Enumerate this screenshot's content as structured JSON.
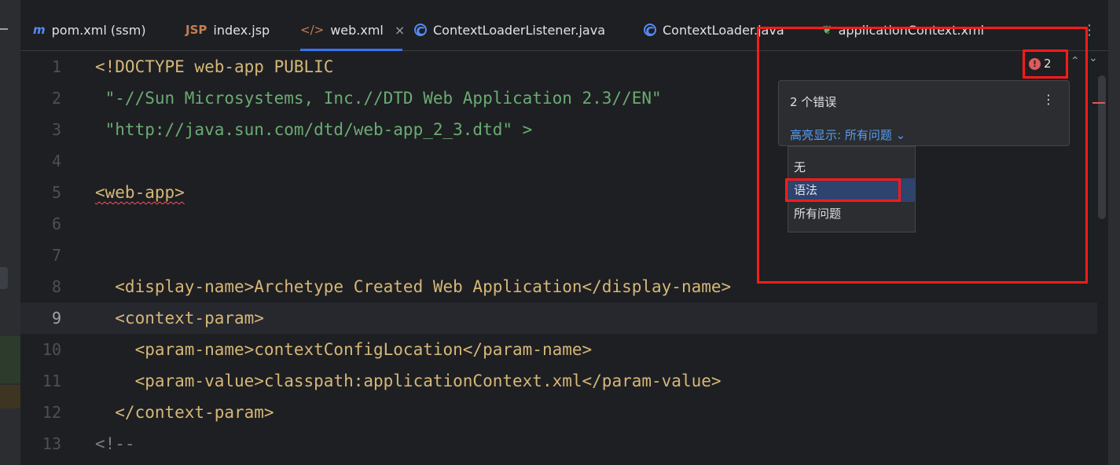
{
  "tabs": [
    {
      "label": "pom.xml (ssm)",
      "icon": "maven-icon",
      "glyph": "m",
      "active": false
    },
    {
      "label": "index.jsp",
      "icon": "jsp-file-icon",
      "glyph": "JSP",
      "active": false
    },
    {
      "label": "web.xml",
      "icon": "xml-file-icon",
      "glyph": "</>",
      "active": true
    },
    {
      "label": "ContextLoaderListener.java",
      "icon": "class-icon",
      "glyph": "C",
      "active": false
    },
    {
      "label": "ContextLoader.java",
      "icon": "class-icon",
      "glyph": "C",
      "active": false
    },
    {
      "label": "applicationContext.xml",
      "icon": "spring-xml-icon",
      "glyph": "",
      "active": false
    }
  ],
  "tab_close_glyph": "×",
  "tab_menu_glyph": "⋮",
  "editor": {
    "current_line": 9,
    "lines": [
      {
        "n": "1",
        "t": "<!DOCTYPE web-app PUBLIC"
      },
      {
        "n": "2",
        "t": " \"-//Sun Microsystems, Inc.//DTD Web Application 2.3//EN\""
      },
      {
        "n": "3",
        "t": " \"http://java.sun.com/dtd/web-app_2_3.dtd\" >"
      },
      {
        "n": "4",
        "t": ""
      },
      {
        "n": "5",
        "t": "<web-app>"
      },
      {
        "n": "6",
        "t": ""
      },
      {
        "n": "7",
        "t": ""
      },
      {
        "n": "8",
        "t": "  <display-name>Archetype Created Web Application</display-name>"
      },
      {
        "n": "9",
        "t": "  <context-param>"
      },
      {
        "n": "10",
        "t": "    <param-name>contextConfigLocation</param-name>"
      },
      {
        "n": "11",
        "t": "    <param-value>classpath:applicationContext.xml</param-value>"
      },
      {
        "n": "12",
        "t": "  </context-param>"
      },
      {
        "n": "13",
        "t": "<!--"
      }
    ]
  },
  "inspection": {
    "error_count": "2",
    "error_icon_glyph": "!",
    "prev_glyph": "⌃",
    "next_glyph": "⌄"
  },
  "popup": {
    "title": "2 个错误",
    "more_glyph": "⋮",
    "highlight_label": "高亮显示: 所有问题",
    "dropdown_arrow": "⌄"
  },
  "dropdown": {
    "selected_index": 1,
    "options": [
      "无",
      "语法",
      "所有问题"
    ]
  },
  "colors": {
    "accent": "#3574f0",
    "tag": "#d5b778",
    "string": "#6aab73",
    "error": "#db5c5c",
    "annotation_red": "#ff1a1a",
    "selected_option": "#2e436e"
  }
}
